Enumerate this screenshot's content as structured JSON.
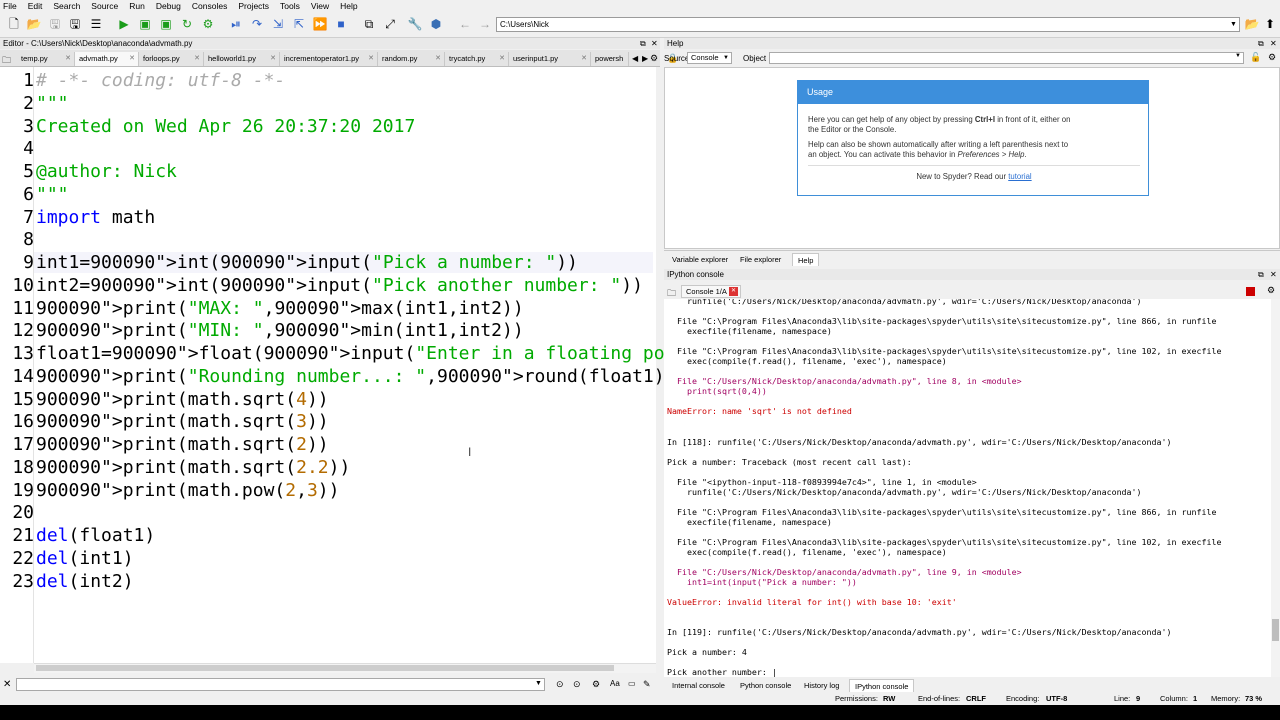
{
  "menu": [
    "File",
    "Edit",
    "Search",
    "Source",
    "Run",
    "Debug",
    "Consoles",
    "Projects",
    "Tools",
    "View",
    "Help"
  ],
  "toolbar": {
    "path": "C:\\Users\\Nick"
  },
  "editor": {
    "title": "Editor - C:\\Users\\Nick\\Desktop\\anaconda\\advmath.py",
    "tabs": [
      "temp.py",
      "advmath.py",
      "forloops.py",
      "helloworld1.py",
      "incrementoperator1.py",
      "random.py",
      "trycatch.py",
      "userinput1.py",
      "powersh"
    ],
    "active_tab": "advmath.py",
    "lines": [
      {
        "n": "1",
        "t": "# -*- coding: utf-8 -*-"
      },
      {
        "n": "2",
        "t": "\"\"\""
      },
      {
        "n": "3",
        "t": "Created on Wed Apr 26 20:37:20 2017"
      },
      {
        "n": "4",
        "t": ""
      },
      {
        "n": "5",
        "t": "@author: Nick"
      },
      {
        "n": "6",
        "t": "\"\"\""
      },
      {
        "n": "7",
        "t": "import math"
      },
      {
        "n": "8",
        "t": ""
      },
      {
        "n": "9",
        "t": "int1=int(input(\"Pick a number: \"))"
      },
      {
        "n": "10",
        "t": "int2=int(input(\"Pick another number: \"))"
      },
      {
        "n": "11",
        "t": "print(\"MAX: \",max(int1,int2))"
      },
      {
        "n": "12",
        "t": "print(\"MIN: \",min(int1,int2))"
      },
      {
        "n": "13",
        "t": "float1=float(input(\"Enter in a floating point number: "
      },
      {
        "n": "14",
        "t": "print(\"Rounding number...: \",round(float1))"
      },
      {
        "n": "15",
        "t": "print(math.sqrt(4))"
      },
      {
        "n": "16",
        "t": "print(math.sqrt(3))"
      },
      {
        "n": "17",
        "t": "print(math.sqrt(2))"
      },
      {
        "n": "18",
        "t": "print(math.sqrt(2.2))"
      },
      {
        "n": "19",
        "t": "print(math.pow(2,3))"
      },
      {
        "n": "20",
        "t": ""
      },
      {
        "n": "21",
        "t": "del(float1)"
      },
      {
        "n": "22",
        "t": "del(int1)"
      },
      {
        "n": "23",
        "t": "del(int2)"
      }
    ]
  },
  "help": {
    "title": "Help",
    "source_label": "Source",
    "source_value": "Console",
    "object_label": "Object",
    "usage_title": "Usage",
    "usage_p1a": "Here you can get help of any object by pressing ",
    "usage_p1b": "Ctrl+I",
    "usage_p1c": " in front of it, either on",
    "usage_p1d": "the Editor or the Console.",
    "usage_p2a": "Help can also be shown automatically after writing a left parenthesis next to",
    "usage_p2b": "an object. You can activate this behavior in ",
    "usage_p2c": "Preferences > Help",
    "usage_p2d": ".",
    "usage_new": "New to Spyder? Read our ",
    "usage_link": "tutorial",
    "tabs": [
      "Variable explorer",
      "File explorer",
      "Help"
    ]
  },
  "console": {
    "title": "IPython console",
    "tab": "Console 1/A",
    "lines": [
      {
        "c": "",
        "t": "    runfile('C:/Users/Nick/Desktop/anaconda/advmath.py', wdir='C:/Users/Nick/Desktop/anaconda')"
      },
      {
        "c": "",
        "t": ""
      },
      {
        "c": "",
        "t": "  File \"C:\\Program Files\\Anaconda3\\lib\\site-packages\\spyder\\utils\\site\\sitecustomize.py\", line 866, in runfile"
      },
      {
        "c": "",
        "t": "    execfile(filename, namespace)"
      },
      {
        "c": "",
        "t": ""
      },
      {
        "c": "",
        "t": "  File \"C:\\Program Files\\Anaconda3\\lib\\site-packages\\spyder\\utils\\site\\sitecustomize.py\", line 102, in execfile"
      },
      {
        "c": "",
        "t": "    exec(compile(f.read(), filename, 'exec'), namespace)"
      },
      {
        "c": "",
        "t": ""
      },
      {
        "c": "mag",
        "t": "  File \"C:/Users/Nick/Desktop/anaconda/advmath.py\", line 8, in <module>"
      },
      {
        "c": "mag",
        "t": "    print(sqrt(0,4))"
      },
      {
        "c": "",
        "t": ""
      },
      {
        "c": "red",
        "t": "NameError: name 'sqrt' is not defined"
      },
      {
        "c": "",
        "t": ""
      },
      {
        "c": "",
        "t": ""
      },
      {
        "c": "",
        "t": "In [118]: runfile('C:/Users/Nick/Desktop/anaconda/advmath.py', wdir='C:/Users/Nick/Desktop/anaconda')"
      },
      {
        "c": "",
        "t": ""
      },
      {
        "c": "",
        "t": "Pick a number: Traceback (most recent call last):"
      },
      {
        "c": "",
        "t": ""
      },
      {
        "c": "",
        "t": "  File \"<ipython-input-118-f0893994e7c4>\", line 1, in <module>"
      },
      {
        "c": "",
        "t": "    runfile('C:/Users/Nick/Desktop/anaconda/advmath.py', wdir='C:/Users/Nick/Desktop/anaconda')"
      },
      {
        "c": "",
        "t": ""
      },
      {
        "c": "",
        "t": "  File \"C:\\Program Files\\Anaconda3\\lib\\site-packages\\spyder\\utils\\site\\sitecustomize.py\", line 866, in runfile"
      },
      {
        "c": "",
        "t": "    execfile(filename, namespace)"
      },
      {
        "c": "",
        "t": ""
      },
      {
        "c": "",
        "t": "  File \"C:\\Program Files\\Anaconda3\\lib\\site-packages\\spyder\\utils\\site\\sitecustomize.py\", line 102, in execfile"
      },
      {
        "c": "",
        "t": "    exec(compile(f.read(), filename, 'exec'), namespace)"
      },
      {
        "c": "",
        "t": ""
      },
      {
        "c": "mag",
        "t": "  File \"C:/Users/Nick/Desktop/anaconda/advmath.py\", line 9, in <module>"
      },
      {
        "c": "mag",
        "t": "    int1=int(input(\"Pick a number: \"))"
      },
      {
        "c": "",
        "t": ""
      },
      {
        "c": "red",
        "t": "ValueError: invalid literal for int() with base 10: 'exit'"
      },
      {
        "c": "",
        "t": ""
      },
      {
        "c": "",
        "t": ""
      },
      {
        "c": "",
        "t": "In [119]: runfile('C:/Users/Nick/Desktop/anaconda/advmath.py', wdir='C:/Users/Nick/Desktop/anaconda')"
      },
      {
        "c": "",
        "t": ""
      },
      {
        "c": "",
        "t": "Pick a number: 4"
      },
      {
        "c": "",
        "t": ""
      },
      {
        "c": "",
        "t": "Pick another number: |"
      }
    ],
    "bottom_tabs": [
      "Internal console",
      "Python console",
      "History log",
      "IPython console"
    ]
  },
  "status": {
    "permissions_label": "Permissions:",
    "permissions_value": "RW",
    "eol_label": "End-of-lines:",
    "eol_value": "CRLF",
    "encoding_label": "Encoding:",
    "encoding_value": "UTF-8",
    "line_label": "Line:",
    "line_value": "9",
    "column_label": "Column:",
    "column_value": "1",
    "memory_label": "Memory:",
    "memory_value": "73 %"
  }
}
